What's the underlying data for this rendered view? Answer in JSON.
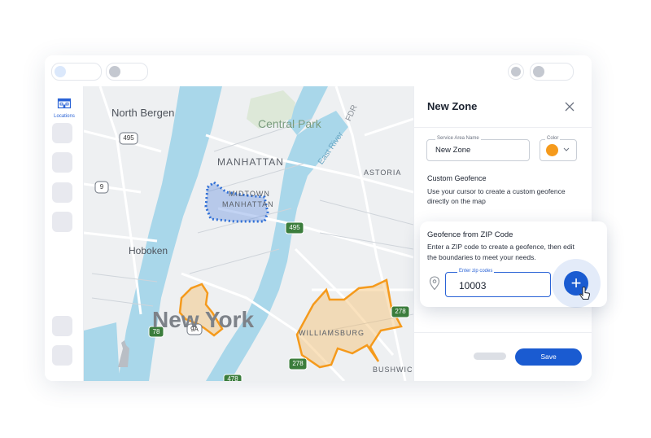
{
  "sidebar": {
    "locations_label": "Locations",
    "locations_icon": "building-icon"
  },
  "map": {
    "labels": {
      "north_bergen": "North Bergen",
      "central_park": "Central Park",
      "manhattan": "MANHATTAN",
      "astoria": "ASTORIA",
      "midtown_a": "MIDTOWN",
      "midtown_b": "MANHATTAN",
      "hoboken": "Hoboken",
      "new_york": "New York",
      "williamsburg": "WILLIAMSBURG",
      "bushwick": "BUSHWIC",
      "east_river": "East River",
      "fdr": "FDR"
    },
    "shields": {
      "r495_top": "495",
      "r9": "9",
      "r495_mid": "495",
      "r278_right": "278",
      "r9a": "9A",
      "r78": "78",
      "r278_bottom": "278",
      "r478": "478"
    },
    "colors": {
      "water": "#a9d7ea",
      "drawn_zone": "#2f6fd6",
      "zip_zone": "#f59a1c"
    }
  },
  "panel": {
    "title": "New Zone",
    "service_area_label": "Service Area Name",
    "service_area_value": "New Zone",
    "color_label": "Color",
    "color_value": "#f59a1c",
    "custom_geofence_title": "Custom Geofence",
    "custom_geofence_line1": "Use your cursor to create a custom geofence",
    "custom_geofence_line2": "directly on the map",
    "save_label": "Save"
  },
  "zip_card": {
    "title": "Geofence from ZIP Code",
    "desc_line1": "Enter a ZIP code to create a geofence, then edit",
    "desc_line2": "the boundaries to meet your needs.",
    "input_label": "Enter zip codes",
    "input_value": "10003",
    "add_symbol": "+",
    "accent": "#1a5bd1"
  }
}
